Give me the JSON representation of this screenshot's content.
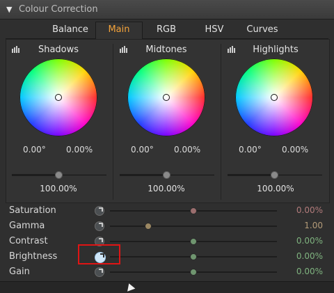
{
  "panel": {
    "title": "Colour Correction",
    "collapse_icon": "triangle-down-icon"
  },
  "tabs": [
    {
      "label": "Balance",
      "active": false
    },
    {
      "label": "Main",
      "active": true
    },
    {
      "label": "RGB",
      "active": false
    },
    {
      "label": "HSV",
      "active": false
    },
    {
      "label": "Curves",
      "active": false
    }
  ],
  "wheels": [
    {
      "title": "Shadows",
      "hue": "0.00°",
      "sat": "0.00%",
      "level": "100.00%",
      "level_value": 0.5
    },
    {
      "title": "Midtones",
      "hue": "0.00°",
      "sat": "0.00%",
      "level": "100.00%",
      "level_value": 0.5
    },
    {
      "title": "Highlights",
      "hue": "0.00°",
      "sat": "0.00%",
      "level": "100.00%",
      "level_value": 0.5
    }
  ],
  "sliders": [
    {
      "label": "Saturation",
      "value": "0.00%",
      "fraction": 0.5,
      "thumb_color": "#9b6e6e",
      "value_class": "val-red"
    },
    {
      "label": "Gamma",
      "value": "1.00",
      "fraction": 0.23,
      "thumb_color": "#9b8762",
      "value_class": "val-tan"
    },
    {
      "label": "Contrast",
      "value": "0.00%",
      "fraction": 0.5,
      "thumb_color": "#6f956f",
      "value_class": "val-green"
    },
    {
      "label": "Brightness",
      "value": "0.00%",
      "fraction": 0.5,
      "thumb_color": "#6f956f",
      "value_class": "val-green",
      "highlighted": true
    },
    {
      "label": "Gain",
      "value": "0.00%",
      "fraction": 0.5,
      "thumb_color": "#6f956f",
      "value_class": "val-green"
    }
  ],
  "colors": {
    "accent_tab": "#f5a33a",
    "highlight_box": "#e01414"
  }
}
